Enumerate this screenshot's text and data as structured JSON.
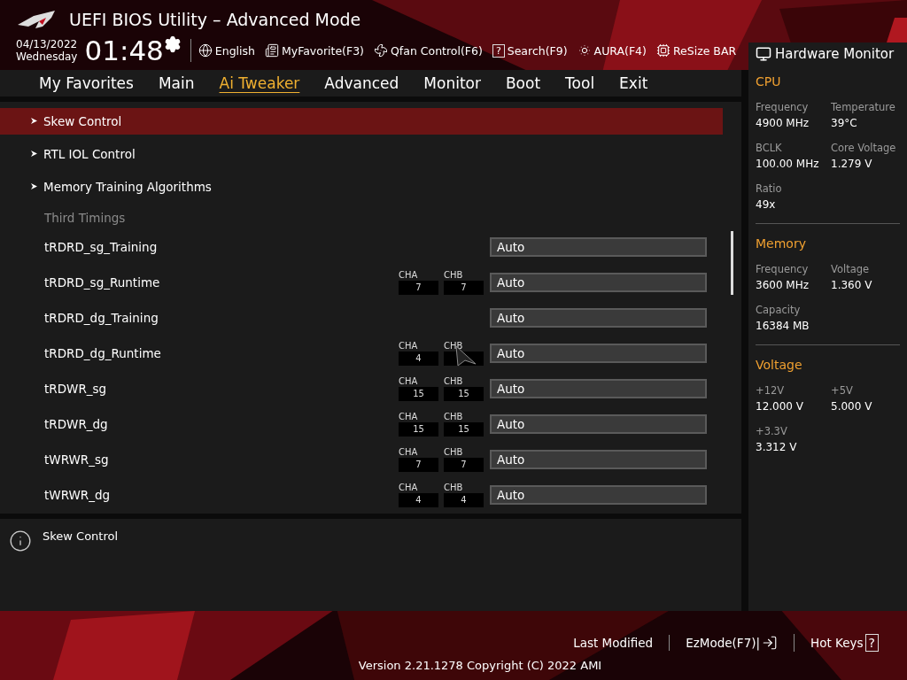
{
  "window": {
    "title": "UEFI BIOS Utility – Advanced Mode"
  },
  "toolbar": {
    "date": "04/13/2022",
    "day": "Wednesday",
    "time": "01:48",
    "items": [
      {
        "kind": "language",
        "label": "English"
      },
      {
        "kind": "favorite",
        "label": "MyFavorite(F3)"
      },
      {
        "kind": "fan",
        "label": "Qfan Control(F6)"
      },
      {
        "kind": "search",
        "icon": "?",
        "label": "Search(F9)"
      },
      {
        "kind": "aura",
        "label": "AURA(F4)"
      },
      {
        "kind": "resizebar",
        "label": "ReSize BAR"
      }
    ]
  },
  "tabs": [
    {
      "label": "My Favorites",
      "selected": false
    },
    {
      "label": "Main",
      "selected": false
    },
    {
      "label": "Ai Tweaker",
      "selected": true
    },
    {
      "label": "Advanced",
      "selected": false
    },
    {
      "label": "Monitor",
      "selected": false
    },
    {
      "label": "Boot",
      "selected": false
    },
    {
      "label": "Tool",
      "selected": false
    },
    {
      "label": "Exit",
      "selected": false
    }
  ],
  "menu": {
    "items": [
      {
        "kind": "submenu",
        "label": "Skew Control",
        "selected": true
      },
      {
        "kind": "submenu",
        "label": "RTL IOL Control",
        "selected": false
      },
      {
        "kind": "submenu",
        "label": "Memory Training Algorithms",
        "selected": false
      },
      {
        "kind": "heading",
        "label": "Third Timings"
      },
      {
        "kind": "setting",
        "label": "tRDRD_sg_Training",
        "value": "Auto",
        "selected": false
      },
      {
        "kind": "setting",
        "label": "tRDRD_sg_Runtime",
        "channels": [
          {
            "label": "CHA",
            "value": "7"
          },
          {
            "label": "CHB",
            "value": "7"
          }
        ],
        "value": "Auto",
        "selected": false
      },
      {
        "kind": "setting",
        "label": "tRDRD_dg_Training",
        "value": "Auto",
        "selected": false
      },
      {
        "kind": "setting",
        "label": "tRDRD_dg_Runtime",
        "channels": [
          {
            "label": "CHA",
            "value": "4"
          },
          {
            "label": "CHB",
            "mouse_pointer": true
          }
        ],
        "value": "Auto",
        "selected": false
      },
      {
        "kind": "setting",
        "label": "tRDWR_sg",
        "channels": [
          {
            "label": "CHA",
            "value": "15"
          },
          {
            "label": "CHB",
            "value": "15"
          }
        ],
        "value": "Auto",
        "selected": false
      },
      {
        "kind": "setting",
        "label": "tRDWR_dg",
        "channels": [
          {
            "label": "CHA",
            "value": "15"
          },
          {
            "label": "CHB",
            "value": "15"
          }
        ],
        "value": "Auto",
        "selected": false
      },
      {
        "kind": "setting",
        "label": "tWRWR_sg",
        "channels": [
          {
            "label": "CHA",
            "value": "7"
          },
          {
            "label": "CHB",
            "value": "7"
          }
        ],
        "value": "Auto",
        "selected": false
      },
      {
        "kind": "setting",
        "label": "tWRWR_dg",
        "channels": [
          {
            "label": "CHA",
            "value": "4"
          },
          {
            "label": "CHB",
            "value": "4"
          }
        ],
        "value": "Auto",
        "selected": false
      }
    ]
  },
  "help": {
    "text": "Skew Control"
  },
  "hardware_monitor": {
    "title": "Hardware Monitor",
    "sections": [
      {
        "title": "CPU",
        "fields": [
          {
            "label": "Frequency",
            "value": "4900 MHz"
          },
          {
            "label": "Temperature",
            "value": "39°C"
          },
          {
            "label": "BCLK",
            "value": "100.00 MHz"
          },
          {
            "label": "Core Voltage",
            "value": "1.279 V"
          },
          {
            "label": "Ratio",
            "value": "49x"
          }
        ]
      },
      {
        "title": "Memory",
        "fields": [
          {
            "label": "Frequency",
            "value": "3600 MHz"
          },
          {
            "label": "Voltage",
            "value": "1.360 V"
          },
          {
            "label": "Capacity",
            "value": "16384 MB"
          }
        ]
      },
      {
        "title": "Voltage",
        "fields": [
          {
            "label": "+12V",
            "value": "12.000 V"
          },
          {
            "label": "+5V",
            "value": "5.000 V"
          },
          {
            "label": "+3.3V",
            "value": "3.312 V"
          }
        ]
      }
    ]
  },
  "footer": {
    "items": [
      {
        "kind": "plain",
        "label": "Last Modified"
      },
      {
        "kind": "exit",
        "label": "EzMode(F7)|"
      },
      {
        "kind": "help",
        "label": "Hot Keys",
        "icon": "?"
      }
    ],
    "version": "Version 2.21.1278 Copyright (C) 2022 AMI"
  }
}
